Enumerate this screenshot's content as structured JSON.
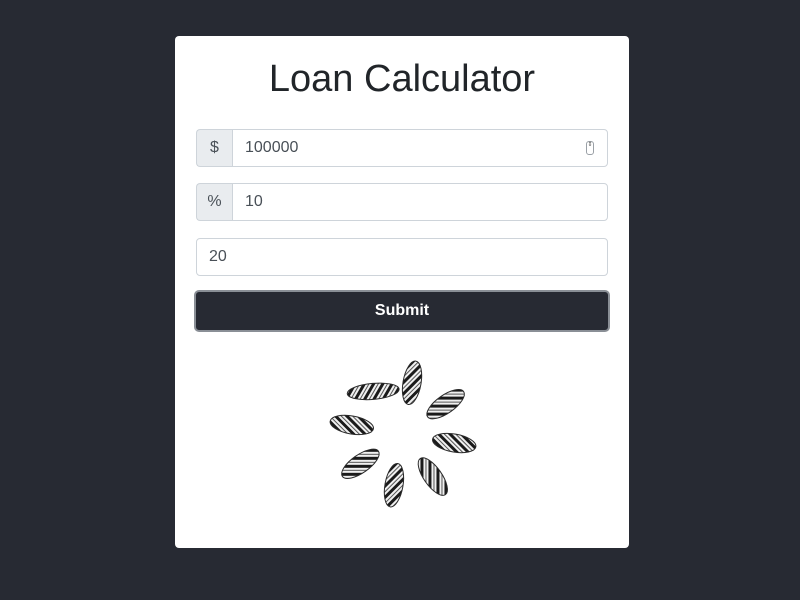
{
  "card": {
    "title": "Loan Calculator"
  },
  "form": {
    "amount": {
      "prefix": "$",
      "value": "100000"
    },
    "interest": {
      "prefix": "%",
      "value": "10"
    },
    "years": {
      "value": "20"
    },
    "submit_label": "Submit"
  },
  "loader": {
    "icon": "loading-spinner-icon",
    "colors": {
      "dark": "#1a1a1a",
      "light": "#e8e8e8"
    }
  },
  "colors": {
    "background": "#272a33",
    "card": "#ffffff",
    "button": "#272a33",
    "prefix_bg": "#e9ecef",
    "border": "#ced4da"
  }
}
